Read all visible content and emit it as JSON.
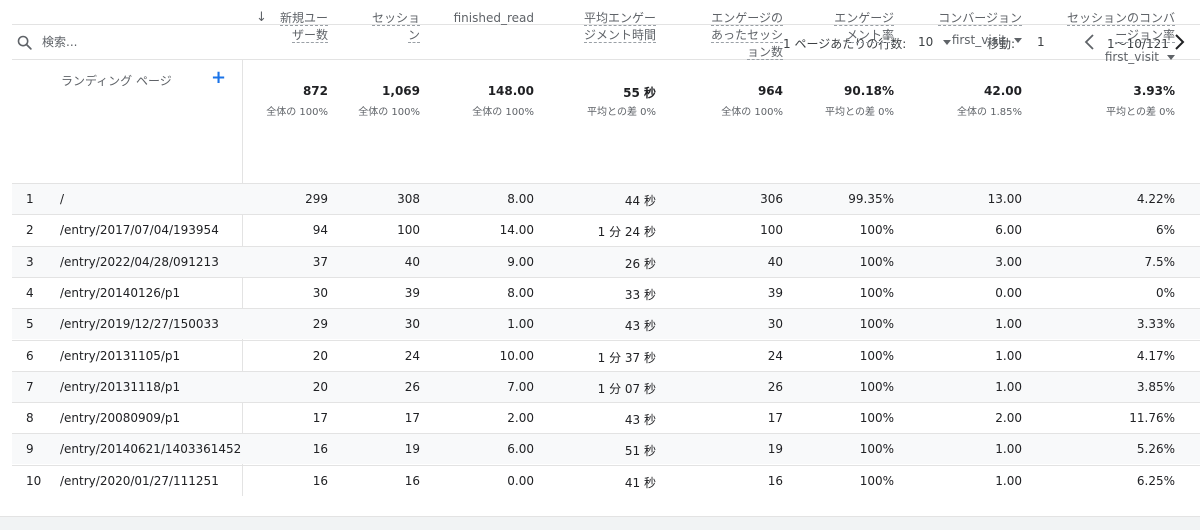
{
  "toolbar": {
    "search_placeholder": "検索...",
    "rows_per_page_label": "1 ページあたりの行数:",
    "rows_per_page_value": "10",
    "goto_label": "移動:",
    "goto_value": "1",
    "page_range": "1〜10/121"
  },
  "table": {
    "dimension_header": "ランディング ページ",
    "add_button": "+",
    "sort_icon": "↓",
    "columns": [
      {
        "lines": [
          "新規ユー",
          "ザー数"
        ],
        "total": "872",
        "total_sub": "全体の 100%"
      },
      {
        "lines": [
          "セッショ",
          "ン"
        ],
        "total": "1,069",
        "total_sub": "全体の 100%"
      },
      {
        "lines": [
          "finished_read"
        ],
        "total": "148.00",
        "total_sub": "全体の 100%"
      },
      {
        "lines": [
          "平均エンゲー",
          "ジメント時間"
        ],
        "total": "55 秒",
        "total_sub": "平均との差 0%"
      },
      {
        "lines": [
          "エンゲージの",
          "あったセッシ",
          "ョン数"
        ],
        "total": "964",
        "total_sub": "全体の 100%"
      },
      {
        "lines": [
          "エンゲージ",
          "メント率"
        ],
        "total": "90.18%",
        "total_sub": "平均との差 0%"
      },
      {
        "lines": [
          "コンバージョン"
        ],
        "select": "first_visit",
        "total": "42.00",
        "total_sub": "全体の 1.85%"
      },
      {
        "lines": [
          "セッションのコンバ",
          "ージョン率"
        ],
        "select": "first_visit",
        "total": "3.93%",
        "total_sub": "平均との差 0%"
      }
    ],
    "rows": [
      {
        "rank": "1",
        "page": "/",
        "values": [
          "299",
          "308",
          "8.00",
          "44 秒",
          "306",
          "99.35%",
          "13.00",
          "4.22%"
        ]
      },
      {
        "rank": "2",
        "page": "/entry/2017/07/04/193954",
        "values": [
          "94",
          "100",
          "14.00",
          "1 分 24 秒",
          "100",
          "100%",
          "6.00",
          "6%"
        ]
      },
      {
        "rank": "3",
        "page": "/entry/2022/04/28/091213",
        "values": [
          "37",
          "40",
          "9.00",
          "26 秒",
          "40",
          "100%",
          "3.00",
          "7.5%"
        ]
      },
      {
        "rank": "4",
        "page": "/entry/20140126/p1",
        "values": [
          "30",
          "39",
          "8.00",
          "33 秒",
          "39",
          "100%",
          "0.00",
          "0%"
        ]
      },
      {
        "rank": "5",
        "page": "/entry/2019/12/27/150033",
        "values": [
          "29",
          "30",
          "1.00",
          "43 秒",
          "30",
          "100%",
          "1.00",
          "3.33%"
        ]
      },
      {
        "rank": "6",
        "page": "/entry/20131105/p1",
        "values": [
          "20",
          "24",
          "10.00",
          "1 分 37 秒",
          "24",
          "100%",
          "1.00",
          "4.17%"
        ]
      },
      {
        "rank": "7",
        "page": "/entry/20131118/p1",
        "values": [
          "20",
          "26",
          "7.00",
          "1 分 07 秒",
          "26",
          "100%",
          "1.00",
          "3.85%"
        ]
      },
      {
        "rank": "8",
        "page": "/entry/20080909/p1",
        "values": [
          "17",
          "17",
          "2.00",
          "43 秒",
          "17",
          "100%",
          "2.00",
          "11.76%"
        ]
      },
      {
        "rank": "9",
        "page": "/entry/20140621/1403361452",
        "values": [
          "16",
          "19",
          "6.00",
          "51 秒",
          "19",
          "100%",
          "1.00",
          "5.26%"
        ]
      },
      {
        "rank": "10",
        "page": "/entry/2020/01/27/111251",
        "values": [
          "16",
          "16",
          "0.00",
          "41 秒",
          "16",
          "100%",
          "1.00",
          "6.25%"
        ]
      }
    ]
  }
}
